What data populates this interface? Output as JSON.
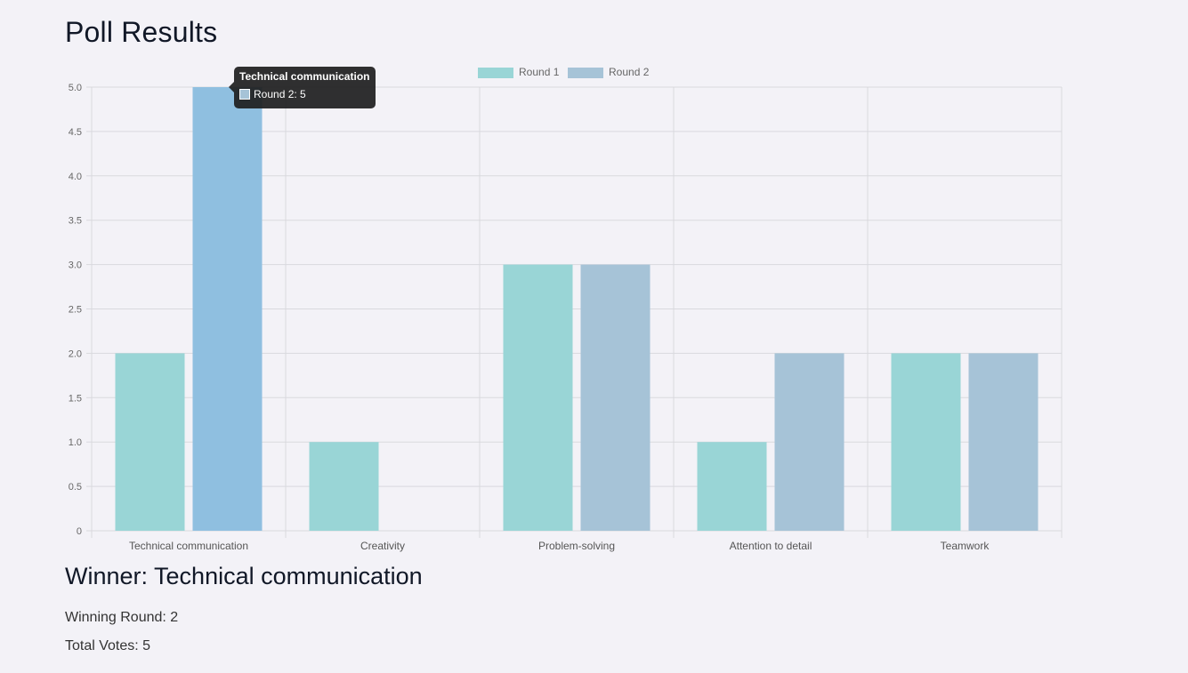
{
  "page": {
    "title": "Poll Results"
  },
  "chart_data": {
    "type": "bar",
    "categories": [
      "Technical communication",
      "Creativity",
      "Problem-solving",
      "Attention to detail",
      "Teamwork"
    ],
    "series": [
      {
        "name": "Round 1",
        "values": [
          2,
          1,
          3,
          1,
          2
        ],
        "color": "#99d5d6"
      },
      {
        "name": "Round 2",
        "values": [
          5,
          0,
          3,
          2,
          2
        ],
        "color": "#a6c3d7"
      }
    ],
    "highlight_color": "#8fbfe0",
    "highlight": {
      "series": 1,
      "category": 0
    },
    "yticks": [
      "0",
      "0.5",
      "1.0",
      "1.5",
      "2.0",
      "2.5",
      "3.0",
      "3.5",
      "4.0",
      "4.5",
      "5.0"
    ],
    "ylim": [
      0,
      5
    ],
    "grid": true,
    "legend": "top"
  },
  "tooltip": {
    "title": "Technical communication",
    "body": "Round 2: 5",
    "swatch_color": "#a6c3d7"
  },
  "result": {
    "winner": "Winner: Technical communication",
    "winning_round": "Winning Round: 2",
    "total_votes": "Total Votes: 5"
  }
}
